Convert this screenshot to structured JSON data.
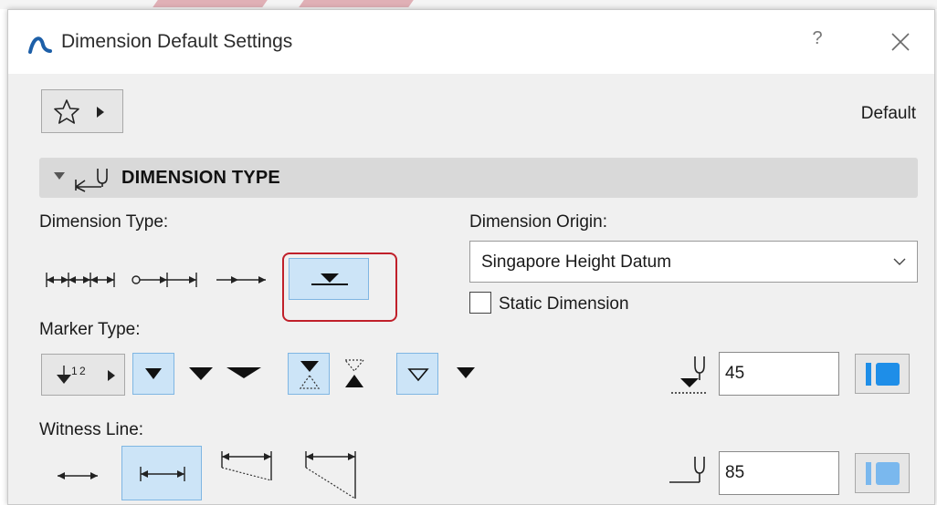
{
  "window": {
    "title": "Dimension Default Settings",
    "app_icon": "archicad-logo-icon",
    "help_label": "?",
    "close_icon": "close-icon"
  },
  "favorites": {
    "icon": "star-icon",
    "arrow": "triangle-right-icon",
    "current_label": "Default"
  },
  "section": {
    "title": "DIMENSION TYPE",
    "collapse_icon": "triangle-down-icon",
    "icon": "dimension-type-icon"
  },
  "dimension_type": {
    "label": "Dimension Type:",
    "options": [
      {
        "icon": "linear-dimension-icon",
        "selected": false
      },
      {
        "icon": "cumulative-dimension-icon",
        "selected": false
      },
      {
        "icon": "arrow-chain-dimension-icon",
        "selected": false
      },
      {
        "icon": "elevation-marker-icon",
        "selected": true
      }
    ]
  },
  "dimension_origin": {
    "label": "Dimension Origin:",
    "value": "Singapore Height Datum",
    "dropdown_icon": "chevron-down-icon"
  },
  "static_dimension": {
    "label": "Static Dimension",
    "checked": false
  },
  "marker_type": {
    "label": "Marker Type:",
    "dropdown_icon": "marker-12-icon",
    "options": [
      {
        "icon": "marker-triangle-filled-small-icon",
        "selected": true
      },
      {
        "icon": "marker-triangle-filled-medium-icon",
        "selected": false
      },
      {
        "icon": "marker-triangle-filled-wide-icon",
        "selected": false
      }
    ],
    "orientation_options": [
      {
        "icon": "marker-hourglass-icon",
        "selected": true
      },
      {
        "icon": "marker-hourglass-dashed-icon",
        "selected": false
      }
    ],
    "fill_options": [
      {
        "icon": "marker-triangle-outline-icon",
        "selected": true
      },
      {
        "icon": "marker-triangle-solid-icon",
        "selected": false
      }
    ],
    "size_icon": "marker-size-icon",
    "size_value": "45",
    "pen_icon": "pen-color-icon"
  },
  "witness_line": {
    "label": "Witness Line:",
    "options": [
      {
        "icon": "witness-none-icon",
        "selected": false
      },
      {
        "icon": "witness-fixed-icon",
        "selected": true
      },
      {
        "icon": "witness-angled-icon",
        "selected": false
      },
      {
        "icon": "witness-angled-long-icon",
        "selected": false
      }
    ],
    "size_icon": "witness-length-icon",
    "size_value": "85",
    "pen_icon": "pen-color-icon"
  },
  "colors": {
    "selection": "#cce4f7",
    "selection_border": "#7fb6e3",
    "highlight_ring": "#c0202a",
    "pen_active": "#1e8ee8",
    "pen_inactive": "#7ab8ee",
    "header_bg": "#d9d9d9",
    "brand_accent": "#1d5fa8"
  }
}
